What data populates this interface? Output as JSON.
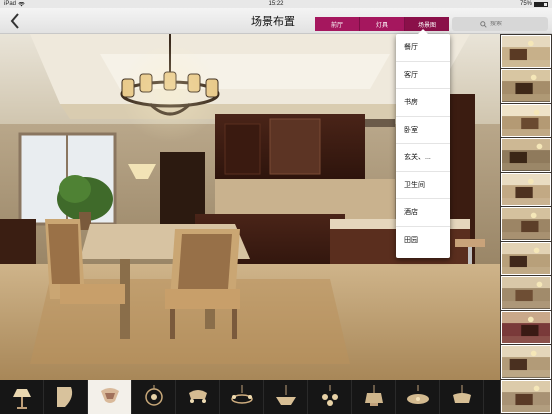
{
  "status_bar": {
    "device": "iPad",
    "wifi_icon": "wifi-icon",
    "time": "15:22",
    "battery_text": "75%",
    "battery_level": 0.75
  },
  "nav": {
    "back_icon": "chevron-left-icon",
    "title": "场景布置",
    "segments": [
      {
        "label": "前厅"
      },
      {
        "label": "灯具"
      },
      {
        "label": "场景图"
      }
    ],
    "active_segment": 2,
    "search_placeholder": "搜索",
    "search_icon": "search-icon",
    "accent_color": "#a5175e"
  },
  "dropdown": {
    "items": [
      {
        "label": "餐厅"
      },
      {
        "label": "客厅"
      },
      {
        "label": "书房"
      },
      {
        "label": "卧室"
      },
      {
        "label": "玄关、..."
      },
      {
        "label": "卫生间"
      },
      {
        "label": "酒店"
      },
      {
        "label": "田园"
      }
    ]
  },
  "scene": {
    "image": "dining-room-with-chandelier"
  },
  "thumbnails": {
    "count": 11
  },
  "products": {
    "count": 11,
    "selected_index": 2
  }
}
